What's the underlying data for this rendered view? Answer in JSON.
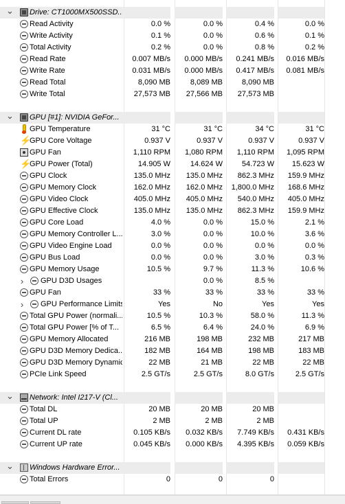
{
  "sections": [
    {
      "title": "Drive: CT1000MX500SSD...",
      "icon": "drive-icon",
      "rows": [
        {
          "label": "Read Activity",
          "icon": "clock-icon",
          "values": [
            "0.0 %",
            "0.0 %",
            "0.4 %",
            "0.0 %"
          ]
        },
        {
          "label": "Write Activity",
          "icon": "clock-icon",
          "values": [
            "0.1 %",
            "0.0 %",
            "0.6 %",
            "0.1 %"
          ]
        },
        {
          "label": "Total Activity",
          "icon": "clock-icon",
          "values": [
            "0.2 %",
            "0.0 %",
            "0.8 %",
            "0.2 %"
          ]
        },
        {
          "label": "Read Rate",
          "icon": "clock-icon",
          "values": [
            "0.007 MB/s",
            "0.000 MB/s",
            "0.241 MB/s",
            "0.016 MB/s"
          ]
        },
        {
          "label": "Write Rate",
          "icon": "clock-icon",
          "values": [
            "0.031 MB/s",
            "0.000 MB/s",
            "0.417 MB/s",
            "0.081 MB/s"
          ]
        },
        {
          "label": "Read Total",
          "icon": "clock-icon",
          "values": [
            "8,090 MB",
            "8,089 MB",
            "8,090 MB",
            ""
          ]
        },
        {
          "label": "Write Total",
          "icon": "clock-icon",
          "values": [
            "27,573 MB",
            "27,566 MB",
            "27,573 MB",
            ""
          ]
        }
      ]
    },
    {
      "title": "GPU [#1]: NVIDIA GeFor...",
      "icon": "gpu-icon",
      "rows": [
        {
          "label": "GPU Temperature",
          "icon": "thermometer-icon",
          "values": [
            "31 °C",
            "31 °C",
            "34 °C",
            "31 °C"
          ]
        },
        {
          "label": "GPU Core Voltage",
          "icon": "lightning-icon",
          "values": [
            "0.937 V",
            "0.937 V",
            "0.937 V",
            "0.937 V"
          ]
        },
        {
          "label": "GPU Fan",
          "icon": "fan-icon",
          "values": [
            "1,110 RPM",
            "1,080 RPM",
            "1,110 RPM",
            "1,095 RPM"
          ]
        },
        {
          "label": "GPU Power (Total)",
          "icon": "lightning-icon",
          "values": [
            "14.905 W",
            "14.624 W",
            "54.723 W",
            "15.623 W"
          ]
        },
        {
          "label": "GPU Clock",
          "icon": "clock-icon",
          "values": [
            "135.0 MHz",
            "135.0 MHz",
            "862.3 MHz",
            "159.9 MHz"
          ]
        },
        {
          "label": "GPU Memory Clock",
          "icon": "clock-icon",
          "values": [
            "162.0 MHz",
            "162.0 MHz",
            "1,800.0 MHz",
            "168.6 MHz"
          ]
        },
        {
          "label": "GPU Video Clock",
          "icon": "clock-icon",
          "values": [
            "405.0 MHz",
            "405.0 MHz",
            "540.0 MHz",
            "405.0 MHz"
          ]
        },
        {
          "label": "GPU Effective Clock",
          "icon": "clock-icon",
          "values": [
            "135.0 MHz",
            "135.0 MHz",
            "862.3 MHz",
            "159.9 MHz"
          ]
        },
        {
          "label": "GPU Core Load",
          "icon": "clock-icon",
          "values": [
            "4.0 %",
            "0.0 %",
            "15.0 %",
            "2.1 %"
          ]
        },
        {
          "label": "GPU Memory Controller L...",
          "icon": "clock-icon",
          "values": [
            "3.0 %",
            "0.0 %",
            "10.0 %",
            "3.6 %"
          ]
        },
        {
          "label": "GPU Video Engine Load",
          "icon": "clock-icon",
          "values": [
            "0.0 %",
            "0.0 %",
            "0.0 %",
            "0.0 %"
          ]
        },
        {
          "label": "GPU Bus Load",
          "icon": "clock-icon",
          "values": [
            "0.0 %",
            "0.0 %",
            "3.0 %",
            "0.3 %"
          ]
        },
        {
          "label": "GPU Memory Usage",
          "icon": "clock-icon",
          "values": [
            "10.5 %",
            "9.7 %",
            "11.3 %",
            "10.6 %"
          ]
        },
        {
          "label": "GPU D3D Usages",
          "icon": "clock-icon",
          "expandable": true,
          "values": [
            "",
            "0.0 %",
            "8.5 %",
            ""
          ]
        },
        {
          "label": "GPU Fan",
          "icon": "clock-icon",
          "values": [
            "33 %",
            "33 %",
            "33 %",
            "33 %"
          ]
        },
        {
          "label": "GPU Performance Limits",
          "icon": "clock-icon",
          "expandable": true,
          "values": [
            "Yes",
            "No",
            "Yes",
            "Yes"
          ]
        },
        {
          "label": "Total GPU Power (normali...",
          "icon": "clock-icon",
          "values": [
            "10.5 %",
            "10.3 %",
            "58.0 %",
            "11.3 %"
          ]
        },
        {
          "label": "Total GPU Power [% of T...",
          "icon": "clock-icon",
          "values": [
            "6.5 %",
            "6.4 %",
            "24.0 %",
            "6.9 %"
          ]
        },
        {
          "label": "GPU Memory Allocated",
          "icon": "clock-icon",
          "values": [
            "216 MB",
            "198 MB",
            "232 MB",
            "217 MB"
          ]
        },
        {
          "label": "GPU D3D Memory Dedica...",
          "icon": "clock-icon",
          "values": [
            "182 MB",
            "164 MB",
            "198 MB",
            "183 MB"
          ]
        },
        {
          "label": "GPU D3D Memory Dynamic",
          "icon": "clock-icon",
          "values": [
            "22 MB",
            "21 MB",
            "22 MB",
            "22 MB"
          ]
        },
        {
          "label": "PCIe Link Speed",
          "icon": "clock-icon",
          "values": [
            "2.5 GT/s",
            "2.5 GT/s",
            "8.0 GT/s",
            "2.5 GT/s"
          ]
        }
      ]
    },
    {
      "title": "Network: Intel I217-V (Cl...",
      "icon": "network-icon",
      "rows": [
        {
          "label": "Total DL",
          "icon": "clock-icon",
          "values": [
            "20 MB",
            "20 MB",
            "20 MB",
            ""
          ]
        },
        {
          "label": "Total UP",
          "icon": "clock-icon",
          "values": [
            "2 MB",
            "2 MB",
            "2 MB",
            ""
          ]
        },
        {
          "label": "Current DL rate",
          "icon": "clock-icon",
          "values": [
            "0.105 KB/s",
            "0.032 KB/s",
            "7.749 KB/s",
            "0.431 KB/s"
          ]
        },
        {
          "label": "Current UP rate",
          "icon": "clock-icon",
          "values": [
            "0.045 KB/s",
            "0.000 KB/s",
            "4.395 KB/s",
            "0.059 KB/s"
          ]
        }
      ]
    },
    {
      "title": "Windows Hardware Error...",
      "icon": "windows-icon",
      "rows": [
        {
          "label": "Total Errors",
          "icon": "clock-icon",
          "values": [
            "0",
            "0",
            "0",
            ""
          ]
        }
      ]
    }
  ]
}
